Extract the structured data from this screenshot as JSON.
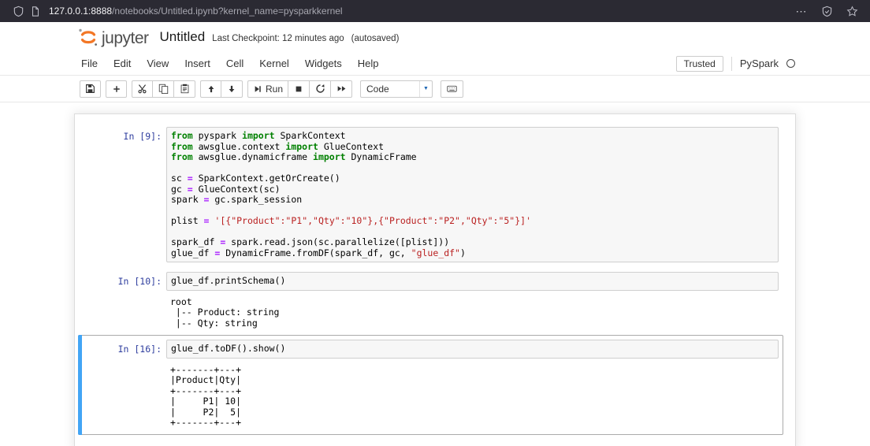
{
  "browser": {
    "url_host": "127.0.0.1:8888",
    "url_path": "/notebooks/Untitled.ipynb?kernel_name=pysparkkernel",
    "overflow_glyph": "⋯"
  },
  "header": {
    "logo_text": "jupyter",
    "title": "Untitled",
    "checkpoint": "Last Checkpoint: 12 minutes ago",
    "autosaved": "(autosaved)"
  },
  "menubar": {
    "items": [
      "File",
      "Edit",
      "View",
      "Insert",
      "Cell",
      "Kernel",
      "Widgets",
      "Help"
    ],
    "trusted_label": "Trusted",
    "kernel_name": "PySpark"
  },
  "toolbar": {
    "run_label": "Run",
    "cell_type_value": "Code"
  },
  "colors": {
    "jupyter_orange": "#F37726",
    "selected_cell_bar": "#42A5F5",
    "input_prompt": "#303F9F",
    "keyword_green": "#008000",
    "string_red": "#BA2121",
    "operator_purple": "#AA22FF"
  },
  "cells": [
    {
      "prompt": "In [9]:",
      "selected": false,
      "code": [
        [
          [
            "kw",
            "from"
          ],
          [
            "pl",
            " pyspark "
          ],
          [
            "kw",
            "import"
          ],
          [
            "pl",
            " SparkContext"
          ]
        ],
        [
          [
            "kw",
            "from"
          ],
          [
            "pl",
            " awsglue.context "
          ],
          [
            "kw",
            "import"
          ],
          [
            "pl",
            " GlueContext"
          ]
        ],
        [
          [
            "kw",
            "from"
          ],
          [
            "pl",
            " awsglue.dynamicframe "
          ],
          [
            "kw",
            "import"
          ],
          [
            "pl",
            " DynamicFrame"
          ]
        ],
        [],
        [
          [
            "pl",
            "sc "
          ],
          [
            "op",
            "="
          ],
          [
            "pl",
            " SparkContext.getOrCreate()"
          ]
        ],
        [
          [
            "pl",
            "gc "
          ],
          [
            "op",
            "="
          ],
          [
            "pl",
            " GlueContext(sc)"
          ]
        ],
        [
          [
            "pl",
            "spark "
          ],
          [
            "op",
            "="
          ],
          [
            "pl",
            " gc.spark_session"
          ]
        ],
        [],
        [
          [
            "pl",
            "plist "
          ],
          [
            "op",
            "="
          ],
          [
            "pl",
            " "
          ],
          [
            "st",
            "'[{\"Product\":\"P1\",\"Qty\":\"10\"},{\"Product\":\"P2\",\"Qty\":\"5\"}]'"
          ]
        ],
        [],
        [
          [
            "pl",
            "spark_df "
          ],
          [
            "op",
            "="
          ],
          [
            "pl",
            " spark.read.json(sc.parallelize([plist]))"
          ]
        ],
        [
          [
            "pl",
            "glue_df "
          ],
          [
            "op",
            "="
          ],
          [
            "pl",
            " DynamicFrame.fromDF(spark_df, gc, "
          ],
          [
            "st",
            "\"glue_df\""
          ],
          [
            "pl",
            ")"
          ]
        ]
      ],
      "output": null
    },
    {
      "prompt": "In [10]:",
      "selected": false,
      "code": [
        [
          [
            "pl",
            "glue_df.printSchema()"
          ]
        ]
      ],
      "output": [
        "root",
        " |-- Product: string",
        " |-- Qty: string"
      ]
    },
    {
      "prompt": "In [16]:",
      "selected": true,
      "code": [
        [
          [
            "pl",
            "glue_df.toDF().show()"
          ]
        ]
      ],
      "output": [
        "+-------+---+",
        "|Product|Qty|",
        "+-------+---+",
        "|     P1| 10|",
        "|     P2|  5|",
        "+-------+---+"
      ]
    }
  ]
}
